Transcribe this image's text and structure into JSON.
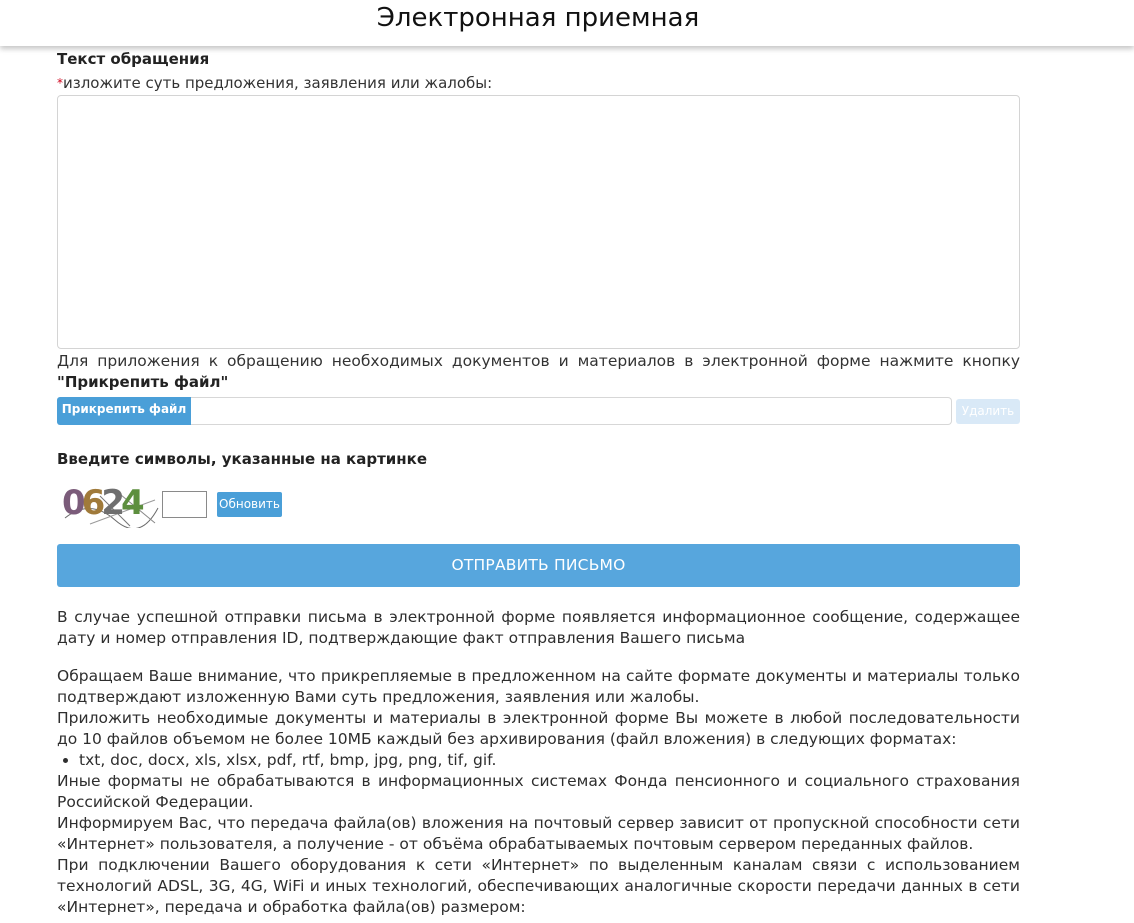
{
  "header": {
    "title": "Электронная приемная"
  },
  "message": {
    "heading": "Текст обращения",
    "required_mark": "*",
    "prompt": "изложите суть предложения, заявления или жалобы:",
    "value": ""
  },
  "attachments": {
    "note": "Для приложения к обращению необходимых документов и материалов в электронной форме нажмите кнопку",
    "note_bold": "\"Прикрепить файл\"",
    "attach_label": "Прикрепить файл",
    "file_name": "",
    "delete_label": "Удалить"
  },
  "captcha": {
    "heading": "Введите символы, указанные на картинке",
    "image_text": "0624",
    "input_value": "",
    "refresh_label": "Обновить"
  },
  "submit": {
    "label": "ОТПРАВИТЬ ПИСЬМО"
  },
  "info": {
    "success_note": "В случае успешной отправки письма в электронной форме появляется информационное сообщение, содержащее дату и номер отправления ID, подтверждающие факт отправления Вашего письма",
    "attention_note": "Обращаем Ваше внимание, что прикрепляемые в предложенном на сайте формате документы и материалы только подтверждают изложенную Вами суть предложения, заявления или жалобы.",
    "formats_intro": "Приложить необходимые документы и материалы в электронной форме Вы можете в любой последовательности до 10 файлов объемом не более 10МБ каждый без архивирования (файл вложения) в следующих форматах:",
    "formats_list": "txt, doc, docx, xls, xlsx, pdf, rtf, bmp, jpg, png, tif, gif.",
    "other_formats": "Иные форматы не обрабатываются в информационных системах Фонда пенсионного и социального страхования Российской Федерации.",
    "transfer_note": "Информируем Вас, что передача файла(ов) вложения на почтовый сервер зависит от пропускной способности сети «Интернет» пользователя, а получение - от объёма обрабатываемых почтовым сервером переданных файлов.",
    "connection_note": "При подключении Вашего оборудования к сети «Интернет» по выделенным каналам связи с использованием технологий ADSL, 3G, 4G, WiFi и иных технологий, обеспечивающих аналогичные скорости передачи данных в сети «Интернет», передача и обработка файла(ов) размером:"
  },
  "colors": {
    "primary_button": "#57a6dd",
    "disabled_button": "#d9e9f7",
    "required": "#d0021b"
  }
}
